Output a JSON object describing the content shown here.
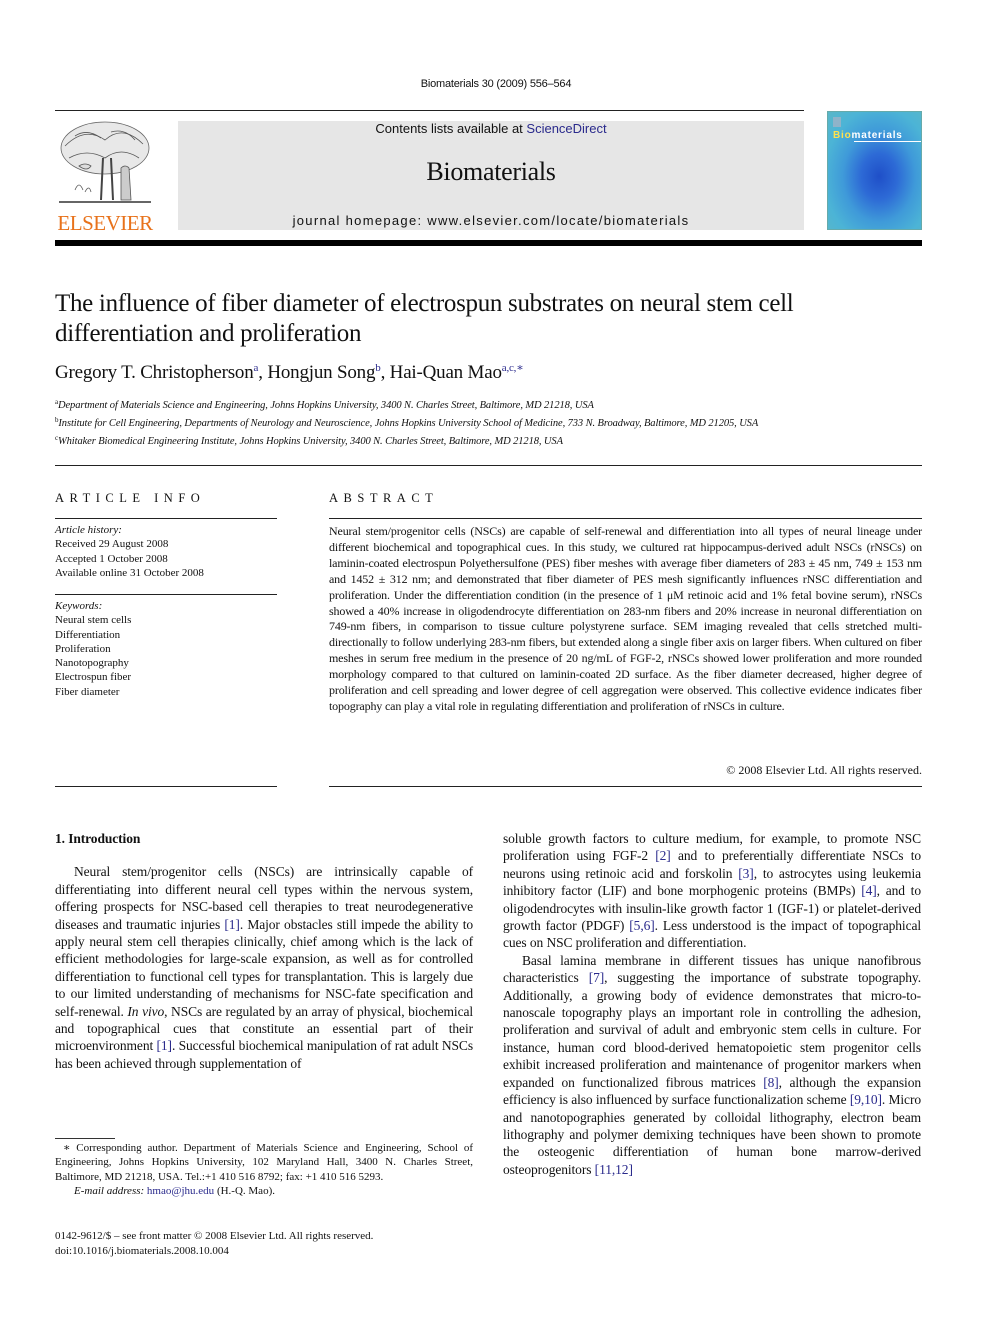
{
  "running_head": "Biomaterials 30 (2009) 556–564",
  "masthead": {
    "contents_prefix": "Contents lists available at ",
    "contents_link": "ScienceDirect",
    "journal_name": "Biomaterials",
    "homepage": "journal homepage: www.elsevier.com/locate/biomaterials",
    "publisher": "ELSEVIER",
    "cover_title_accent": "Bio",
    "cover_title_rest": "materials",
    "link_color": "#2a2a8c",
    "publisher_color": "#e8721b"
  },
  "article": {
    "title": "The influence of fiber diameter of electrospun substrates on neural stem cell differentiation and proliferation",
    "authors": [
      {
        "name": "Gregory T. Christopherson",
        "sup": "a"
      },
      {
        "name": "Hongjun Song",
        "sup": "b"
      },
      {
        "name": "Hai-Quan Mao",
        "sup": "a,c,∗"
      }
    ],
    "affiliations": [
      {
        "sup": "a",
        "text": "Department of Materials Science and Engineering, Johns Hopkins University, 3400 N. Charles Street, Baltimore, MD 21218, USA"
      },
      {
        "sup": "b",
        "text": "Institute for Cell Engineering, Departments of Neurology and Neuroscience, Johns Hopkins University School of Medicine, 733 N. Broadway, Baltimore, MD 21205, USA"
      },
      {
        "sup": "c",
        "text": "Whitaker Biomedical Engineering Institute, Johns Hopkins University, 3400 N. Charles Street, Baltimore, MD 21218, USA"
      }
    ]
  },
  "article_info": {
    "label": "ARTICLE INFO",
    "history_label": "Article history:",
    "history": [
      "Received 29 August 2008",
      "Accepted 1 October 2008",
      "Available online 31 October 2008"
    ],
    "keywords_label": "Keywords:",
    "keywords": [
      "Neural stem cells",
      "Differentiation",
      "Proliferation",
      "Nanotopography",
      "Electrospun fiber",
      "Fiber diameter"
    ]
  },
  "abstract": {
    "label": "ABSTRACT",
    "text": "Neural stem/progenitor cells (NSCs) are capable of self-renewal and differentiation into all types of neural lineage under different biochemical and topographical cues. In this study, we cultured rat hippocampus-derived adult NSCs (rNSCs) on laminin-coated electrospun Polyethersulfone (PES) fiber meshes with average fiber diameters of 283 ± 45 nm, 749 ± 153 nm and 1452 ± 312 nm; and demonstrated that fiber diameter of PES mesh significantly influences rNSC differentiation and proliferation. Under the differentiation condition (in the presence of 1 μM retinoic acid and 1% fetal bovine serum), rNSCs showed a 40% increase in oligodendrocyte differentiation on 283-nm fibers and 20% increase in neuronal differentiation on 749-nm fibers, in comparison to tissue culture polystyrene surface. SEM imaging revealed that cells stretched multi-directionally to follow underlying 283-nm fibers, but extended along a single fiber axis on larger fibers. When cultured on fiber meshes in serum free medium in the presence of 20 ng/mL of FGF-2, rNSCs showed lower proliferation and more rounded morphology compared to that cultured on laminin-coated 2D surface. As the fiber diameter decreased, higher degree of proliferation and cell spreading and lower degree of cell aggregation were observed. This collective evidence indicates fiber topography can play a vital role in regulating differentiation and proliferation of rNSCs in culture.",
    "copyright": "© 2008 Elsevier Ltd. All rights reserved."
  },
  "body": {
    "intro_heading": "1.  Introduction",
    "left_para": [
      {
        "t": "Neural stem/progenitor cells (NSCs) are intrinsically capable of differentiating into different neural cell types within the nervous system, offering prospects for NSC-based cell therapies to treat neurodegenerative diseases and traumatic injuries "
      },
      {
        "ref": "[1]"
      },
      {
        "t": ". Major obstacles still impede the ability to apply neural stem cell therapies clinically, chief among which is the lack of efficient methodologies for large-scale expansion, as well as for controlled differentiation to functional cell types for transplantation. This is largely due to our limited understanding of mechanisms for NSC-fate specification and self-renewal. "
      },
      {
        "i": "In vivo"
      },
      {
        "t": ", NSCs are regulated by an array of physical, biochemical and topographical cues that constitute an essential part of their microenvironment "
      },
      {
        "ref": "[1]"
      },
      {
        "t": ". Successful biochemical manipulation of rat adult NSCs has been achieved through supplementation of"
      }
    ],
    "right_para_1": [
      {
        "t": "soluble growth factors to culture medium, for example, to promote NSC proliferation using FGF-2 "
      },
      {
        "ref": "[2]"
      },
      {
        "t": " and to preferentially differentiate NSCs to neurons using retinoic acid and forskolin "
      },
      {
        "ref": "[3]"
      },
      {
        "t": ", to astrocytes using leukemia inhibitory factor (LIF) and bone morphogenic proteins (BMPs) "
      },
      {
        "ref": "[4]"
      },
      {
        "t": ", and to oligodendrocytes with insulin-like growth factor 1 (IGF-1) or platelet-derived growth factor (PDGF) "
      },
      {
        "ref": "[5,6]"
      },
      {
        "t": ". Less understood is the impact of topographical cues on NSC proliferation and differentiation."
      }
    ],
    "right_para_2": [
      {
        "t": "Basal lamina membrane in different tissues has unique nanofibrous characteristics "
      },
      {
        "ref": "[7]"
      },
      {
        "t": ", suggesting the importance of substrate topography. Additionally, a growing body of evidence demonstrates that micro-to-nanoscale topography plays an important role in controlling the adhesion, proliferation and survival of adult and embryonic stem cells in culture. For instance, human cord blood-derived hematopoietic stem progenitor cells exhibit increased proliferation and maintenance of progenitor markers when expanded on functionalized fibrous matrices "
      },
      {
        "ref": "[8]"
      },
      {
        "t": ", although the expansion efficiency is also influenced by surface functionalization scheme "
      },
      {
        "ref": "[9,10]"
      },
      {
        "t": ". Micro and nanotopographies generated by colloidal lithography, electron beam lithography and polymer demixing techniques have been shown to promote the osteogenic differentiation of human bone marrow-derived osteoprogenitors "
      },
      {
        "ref": "[11,12]"
      }
    ]
  },
  "footnote": {
    "corresponding": "∗ Corresponding author. Department of Materials Science and Engineering, School of Engineering, Johns Hopkins University, 102 Maryland Hall, 3400 N. Charles Street, Baltimore, MD 21218, USA. Tel.:+1 410 516 8792; fax: +1 410 516 5293.",
    "email_label": "E-mail address:",
    "email": "hmao@jhu.edu",
    "email_suffix": " (H.-Q. Mao)."
  },
  "front_matter": {
    "issn_line": "0142-9612/$ – see front matter © 2008 Elsevier Ltd. All rights reserved.",
    "doi": "doi:10.1016/j.biomaterials.2008.10.004"
  }
}
